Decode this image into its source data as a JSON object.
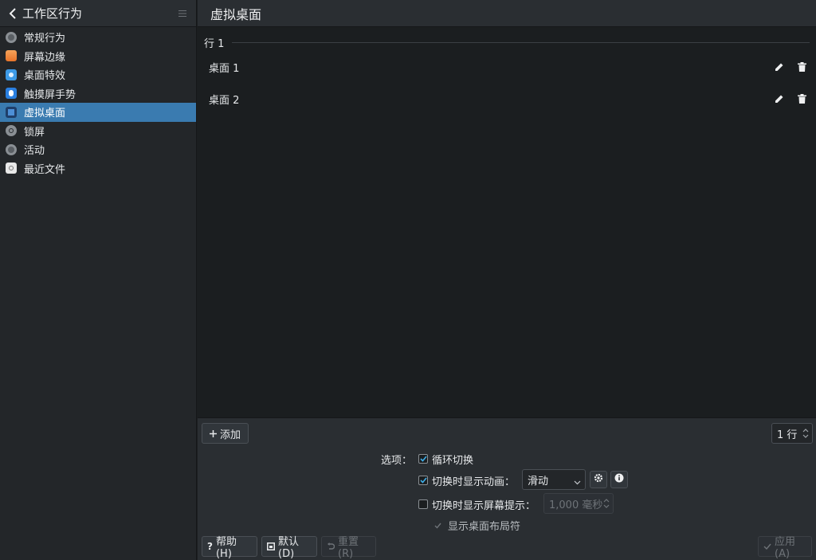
{
  "sidebar": {
    "title": "工作区行为",
    "items": [
      {
        "label": "常规行为",
        "icon": "general-behavior-icon",
        "color": "#8a8f94"
      },
      {
        "label": "屏幕边缘",
        "icon": "screen-edges-icon",
        "color": "#e8742a"
      },
      {
        "label": "桌面特效",
        "icon": "desktop-effects-icon",
        "color": "#3d9ae6"
      },
      {
        "label": "触摸屏手势",
        "icon": "touch-gestures-icon",
        "color": "#2a7fe0"
      },
      {
        "label": "虚拟桌面",
        "icon": "virtual-desktops-icon",
        "color": "#2f5f9e"
      },
      {
        "label": "锁屏",
        "icon": "screen-lock-icon",
        "color": "#8a8f94"
      },
      {
        "label": "活动",
        "icon": "activities-icon",
        "color": "#8a8f94"
      },
      {
        "label": "最近文件",
        "icon": "recent-files-icon",
        "color": "#d8d8d8"
      }
    ]
  },
  "main": {
    "title": "虚拟桌面",
    "row_label": "行 1",
    "desktops": [
      {
        "name": "桌面 1"
      },
      {
        "name": "桌面 2"
      }
    ]
  },
  "bottom": {
    "add_label": "添加",
    "rows_value": "1 行",
    "options_label": "选项：",
    "wrap_label": "循环切换",
    "wrap_checked": true,
    "animation_label": "切换时显示动画：",
    "animation_checked": true,
    "animation_value": "滑动",
    "osd_label": "切换时显示屏幕提示：",
    "osd_checked": false,
    "osd_duration": "1,000 毫秒",
    "layout_label": "显示桌面布局符",
    "help_label": "帮助(H)",
    "defaults_label": "默认(D)",
    "reset_label": "重置(R)",
    "apply_label": "应用(A)"
  },
  "colors": {
    "accent": "#3a7bb0",
    "background": "#1b1e20",
    "panel": "#2a2e32"
  }
}
